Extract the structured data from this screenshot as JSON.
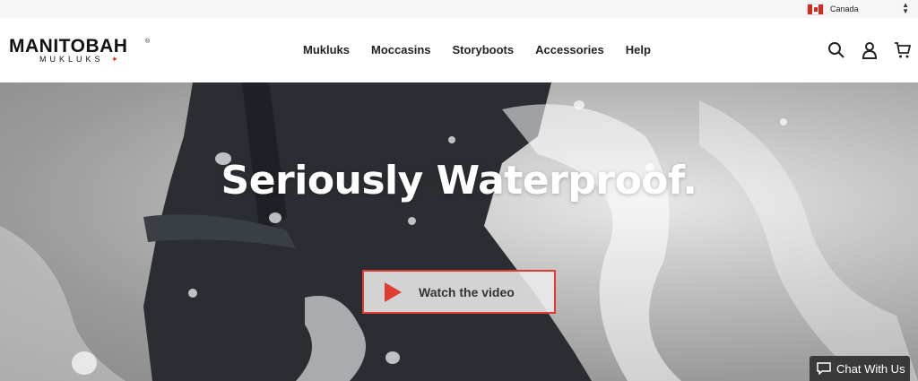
{
  "topbar": {
    "country": "Canada"
  },
  "brand": {
    "name": "MANITOBAH",
    "sub": "MUKLUKS",
    "reg": "®"
  },
  "nav": {
    "items": [
      {
        "label": "Mukluks"
      },
      {
        "label": "Moccasins"
      },
      {
        "label": "Storyboots"
      },
      {
        "label": "Accessories"
      },
      {
        "label": "Help"
      }
    ]
  },
  "header_icons": [
    "search-icon",
    "account-icon",
    "cart-icon"
  ],
  "hero": {
    "title": "Seriously Waterproof.",
    "cta_label": "Watch the video"
  },
  "chat": {
    "label": "Chat With Us"
  },
  "colors": {
    "accent": "#e03c31",
    "flag_red": "#d52b1e",
    "chat_bg": "#3a3a3a"
  }
}
